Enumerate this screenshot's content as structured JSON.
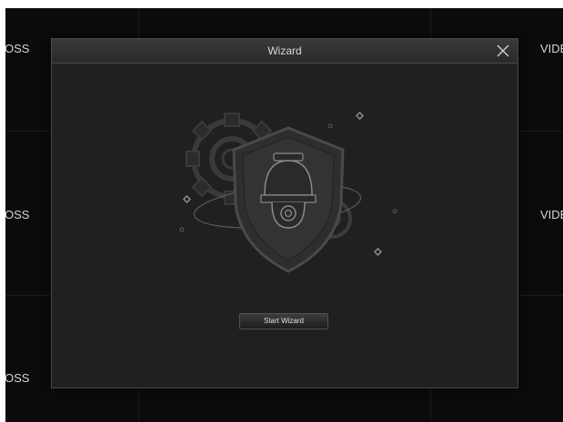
{
  "background_cells": {
    "left_labels": [
      "OSS",
      "OSS",
      "OSS"
    ],
    "right_labels": [
      "VIDE",
      "VIDE"
    ]
  },
  "dialog": {
    "title": "Wizard",
    "close_icon": "close-icon",
    "illustration_icon": "security-camera-shield-icon",
    "start_button_label": "Start Wizard"
  },
  "colors": {
    "screen_bg": "#0b0b0b",
    "dialog_bg": "#202020",
    "header_bg": "#333333",
    "text": "#d8d8d8"
  }
}
